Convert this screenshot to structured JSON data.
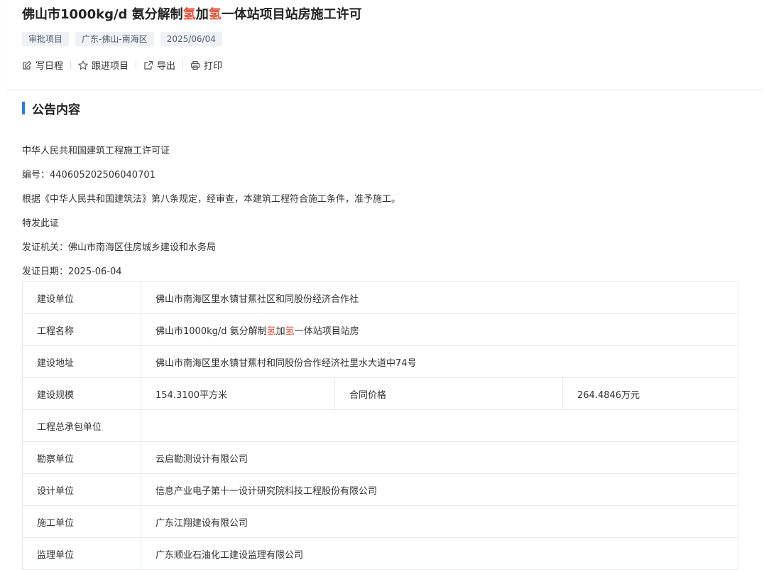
{
  "header": {
    "title_parts": [
      "佛山市1000kg/d 氨分解制",
      "氢",
      "加",
      "氢",
      "一体站项目站房施工许可"
    ],
    "tags": [
      "审批项目",
      "广东-佛山-南海区",
      "2025/06/04"
    ],
    "actions": {
      "write_schedule": "写日程",
      "follow_project": "跟进项目",
      "export": "导出",
      "print": "打印"
    }
  },
  "section": {
    "title": "公告内容"
  },
  "notice": {
    "line1": "中华人民共和国建筑工程施工许可证",
    "line2": "编号：440605202506040701",
    "line3": "根据《中华人民共和国建筑法》第八条规定，经审查，本建筑工程符合施工条件，准予施工。",
    "line4": "特发此证",
    "line5": "发证机关：佛山市南海区住房城乡建设和水务局",
    "line6": "发证日期：2025-06-04"
  },
  "table": {
    "build_unit_label": "建设单位",
    "build_unit_value": "佛山市南海区里水镇甘蕉社区和同股份经济合作社",
    "project_name_label": "工程名称",
    "project_name_parts": [
      "佛山市1000kg/d 氨分解制",
      "氢",
      "加",
      "氢",
      "一体站项目站房"
    ],
    "address_label": "建设地址",
    "address_value": "佛山市南海区里水镇甘蕉村和同股份合作经济社里水大道中74号",
    "scale_label": "建设规模",
    "scale_value": "154.3100平方米",
    "price_label": "合同价格",
    "price_value": "264.4846万元",
    "contractor_label": "工程总承包单位",
    "contractor_value": "",
    "survey_label": "勘察单位",
    "survey_value": "云启勘测设计有限公司",
    "design_label": "设计单位",
    "design_value": "信息产业电子第十一设计研究院科技工程股份有限公司",
    "construction_label": "施工单位",
    "construction_value": "广东江翔建设有限公司",
    "supervision_label": "监理单位",
    "supervision_value": "广东顺业石油化工建设监理有限公司"
  },
  "colors": {
    "accent": "#2f7be5",
    "highlight": "#e2533b",
    "tag_bg": "#eef2f7"
  }
}
